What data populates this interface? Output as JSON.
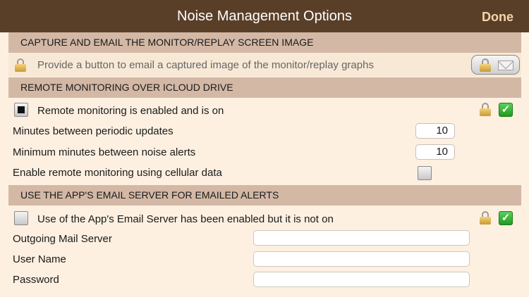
{
  "nav": {
    "title": "Noise Management Options",
    "done_label": "Done"
  },
  "capture": {
    "header": "CAPTURE AND EMAIL THE MONITOR/REPLAY SCREEN IMAGE",
    "option_label": "Provide a button to email a captured image of the monitor/replay graphs"
  },
  "remote": {
    "header": "REMOTE MONITORING OVER ICLOUD DRIVE",
    "enabled_label": "Remote monitoring is enabled and is on",
    "enabled_checked": true,
    "minutes_label": "Minutes between periodic updates",
    "minutes_value": "10",
    "alerts_label": "Minimum minutes between noise alerts",
    "alerts_value": "10",
    "cellular_label": "Enable remote monitoring using cellular data",
    "cellular_checked": false,
    "check_glyph": "✓"
  },
  "email": {
    "header": "USE THE APP'S EMAIL SERVER FOR EMAILED ALERTS",
    "enabled_label": "Use of the App's Email Server has been enabled but it is not on",
    "enabled_checked": false,
    "server_label": "Outgoing Mail Server",
    "server_value": "",
    "user_label": "User Name",
    "user_value": "",
    "password_label": "Password",
    "password_value": "",
    "check_glyph": "✓"
  },
  "icons": [
    "lock-icon",
    "envelope-icon",
    "check-icon"
  ],
  "colors": {
    "navbar": "#5a3f28",
    "done": "#f4d6a8",
    "section": "#d3b8a5",
    "background": "#fdf0e1"
  }
}
